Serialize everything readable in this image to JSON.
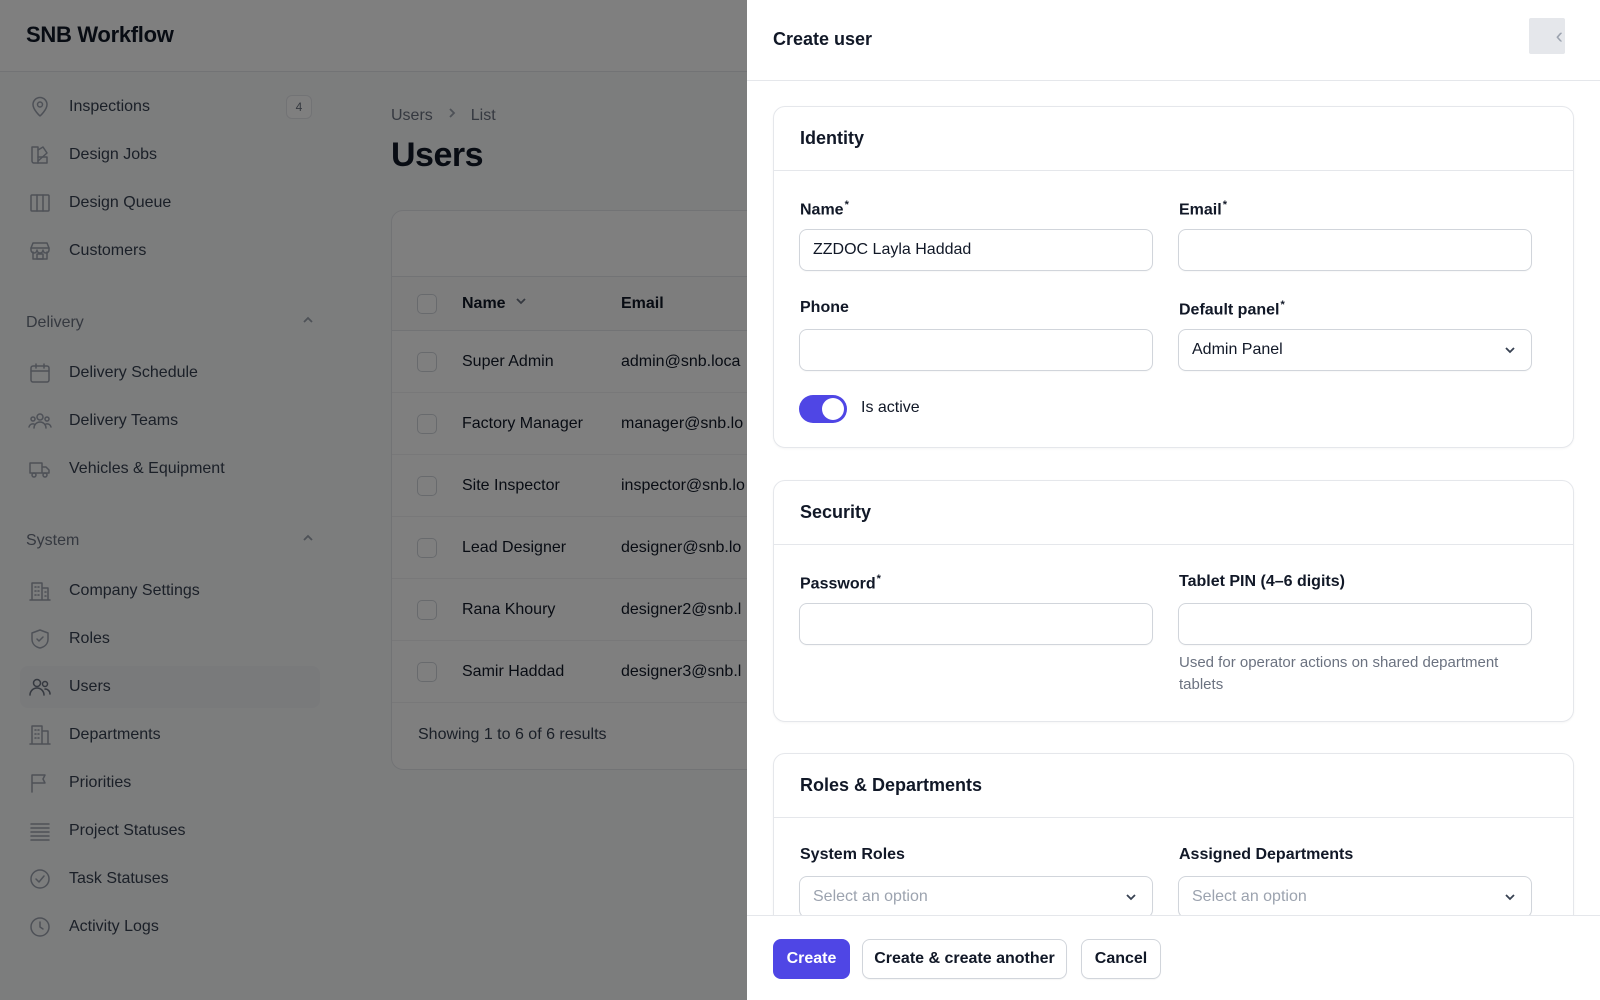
{
  "app": {
    "brand": "SNB Workflow"
  },
  "sidebar": {
    "top_items": [
      {
        "label": "Inspections",
        "icon": "map-pin-icon",
        "badge": "4"
      },
      {
        "label": "Design Jobs",
        "icon": "swatch-icon"
      },
      {
        "label": "Design Queue",
        "icon": "columns-icon"
      },
      {
        "label": "Customers",
        "icon": "storefront-icon"
      }
    ],
    "groups": {
      "delivery": {
        "label": "Delivery",
        "items": [
          {
            "label": "Delivery Schedule",
            "icon": "calendar-icon"
          },
          {
            "label": "Delivery Teams",
            "icon": "user-group-icon"
          },
          {
            "label": "Vehicles & Equipment",
            "icon": "truck-icon"
          }
        ]
      },
      "system": {
        "label": "System",
        "items": [
          {
            "label": "Company Settings",
            "icon": "building-icon"
          },
          {
            "label": "Roles",
            "icon": "shield-check-icon"
          },
          {
            "label": "Users",
            "icon": "users-icon",
            "active": true
          },
          {
            "label": "Departments",
            "icon": "office-building-icon"
          },
          {
            "label": "Priorities",
            "icon": "flag-icon"
          },
          {
            "label": "Project Statuses",
            "icon": "queue-list-icon"
          },
          {
            "label": "Task Statuses",
            "icon": "check-circle-icon"
          },
          {
            "label": "Activity Logs",
            "icon": "clock-icon"
          }
        ]
      }
    }
  },
  "main": {
    "breadcrumb": [
      "Users",
      "List"
    ],
    "title": "Users",
    "table": {
      "columns": [
        "Name",
        "Email"
      ],
      "rows": [
        {
          "name": "Super Admin",
          "email": "admin@snb.loca"
        },
        {
          "name": "Factory Manager",
          "email": "manager@snb.lo"
        },
        {
          "name": "Site Inspector",
          "email": "inspector@snb.lo"
        },
        {
          "name": "Lead Designer",
          "email": "designer@snb.lo"
        },
        {
          "name": "Rana Khoury",
          "email": "designer2@snb.l"
        },
        {
          "name": "Samir Haddad",
          "email": "designer3@snb.l"
        }
      ],
      "footer": "Showing 1 to 6 of 6 results"
    }
  },
  "modal": {
    "title": "Create user",
    "identity": {
      "heading": "Identity",
      "name_label": "Name",
      "name_value": "ZZDOC Layla Haddad",
      "email_label": "Email",
      "email_value": "",
      "phone_label": "Phone",
      "phone_value": "",
      "panel_label": "Default panel",
      "panel_value": "Admin Panel",
      "active_label": "Is active",
      "active": true
    },
    "security": {
      "heading": "Security",
      "password_label": "Password",
      "pin_label": "Tablet PIN (4–6 digits)",
      "pin_hint": "Used for operator actions on shared department tablets"
    },
    "roles": {
      "heading": "Roles & Departments",
      "roles_label": "System Roles",
      "roles_placeholder": "Select an option",
      "departments_label": "Assigned Departments",
      "departments_placeholder": "Select an option"
    },
    "actions": {
      "create": "Create",
      "create_another": "Create & create another",
      "cancel": "Cancel"
    }
  },
  "colors": {
    "primary": "#4f46e5",
    "overlay": "rgba(0,0,0,0.5)"
  }
}
